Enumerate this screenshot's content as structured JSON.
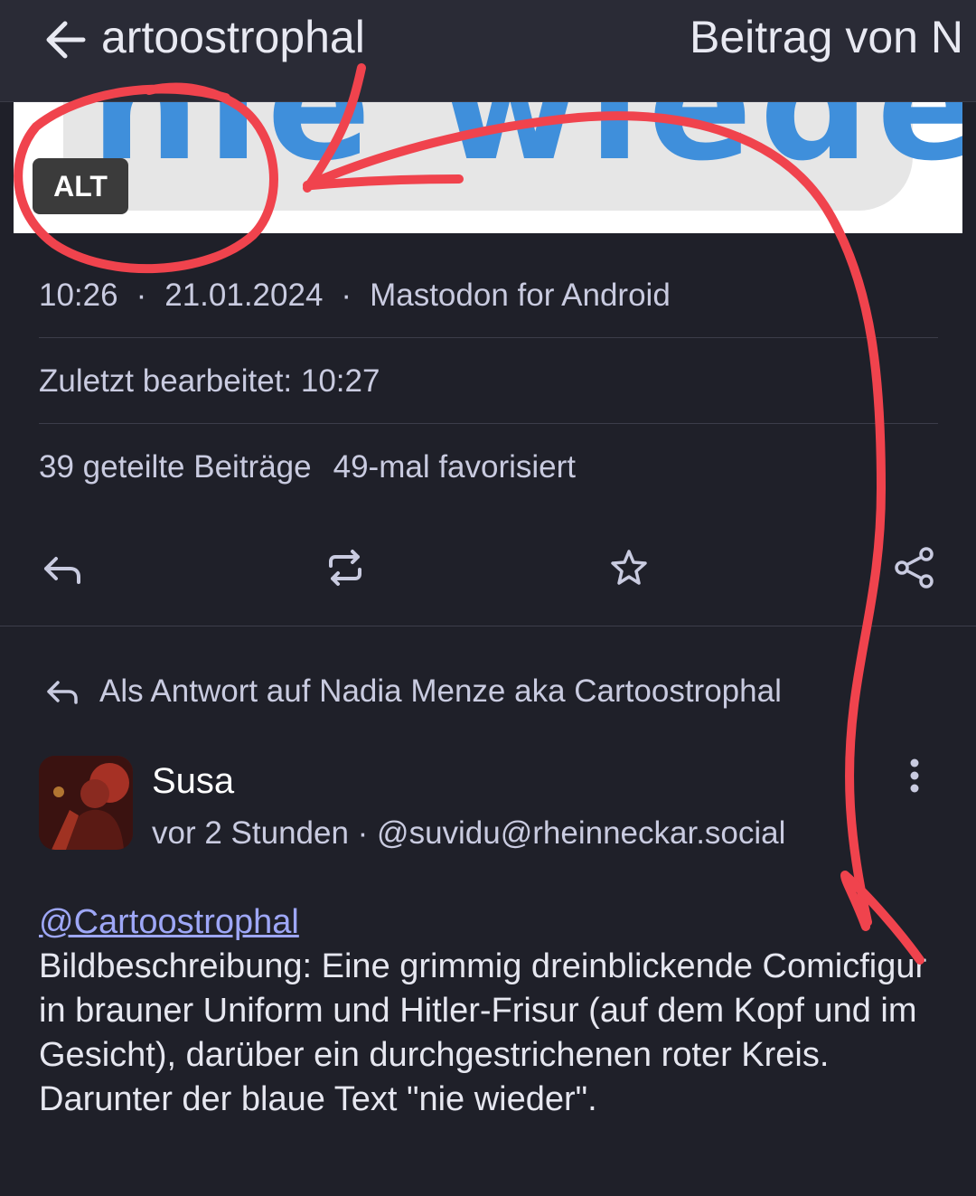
{
  "header": {
    "title_left": "artoostrophal",
    "title_right": "Beitrag von N"
  },
  "image": {
    "visible_text": "nie wieder",
    "alt_badge": "ALT"
  },
  "status": {
    "time": "10:26",
    "date": "21.01.2024",
    "client": "Mastodon for Android",
    "edited": "Zuletzt bearbeitet: 10:27",
    "boosts": "39 geteilte Beiträge",
    "favorites": "49-mal favorisiert"
  },
  "reply": {
    "label": "Als Antwort auf Nadia Menze aka Cartoostrophal",
    "author_name": "Susa",
    "author_meta": "vor 2 Stunden · @suvidu@rheinneckar.social",
    "mention": "@Cartoostrophal",
    "text": "Bildbeschreibung: Eine grimmig dreinblickende Comicfigur in brauner Uniform und Hitler-Frisur (auf dem Kopf und im Gesicht), darüber ein durchgestrichenen roter Kreis. Darunter der blaue Text \"nie wieder\"."
  },
  "icons": [
    "back-arrow-icon",
    "reply-icon",
    "boost-icon",
    "star-icon",
    "share-icon",
    "more-vert-icon"
  ],
  "colors": {
    "background": "#1f2029",
    "toolbar": "#2a2b36",
    "mention": "#9ea7f7",
    "annotation": "#f0434d",
    "image_text": "#3f8fdb"
  }
}
